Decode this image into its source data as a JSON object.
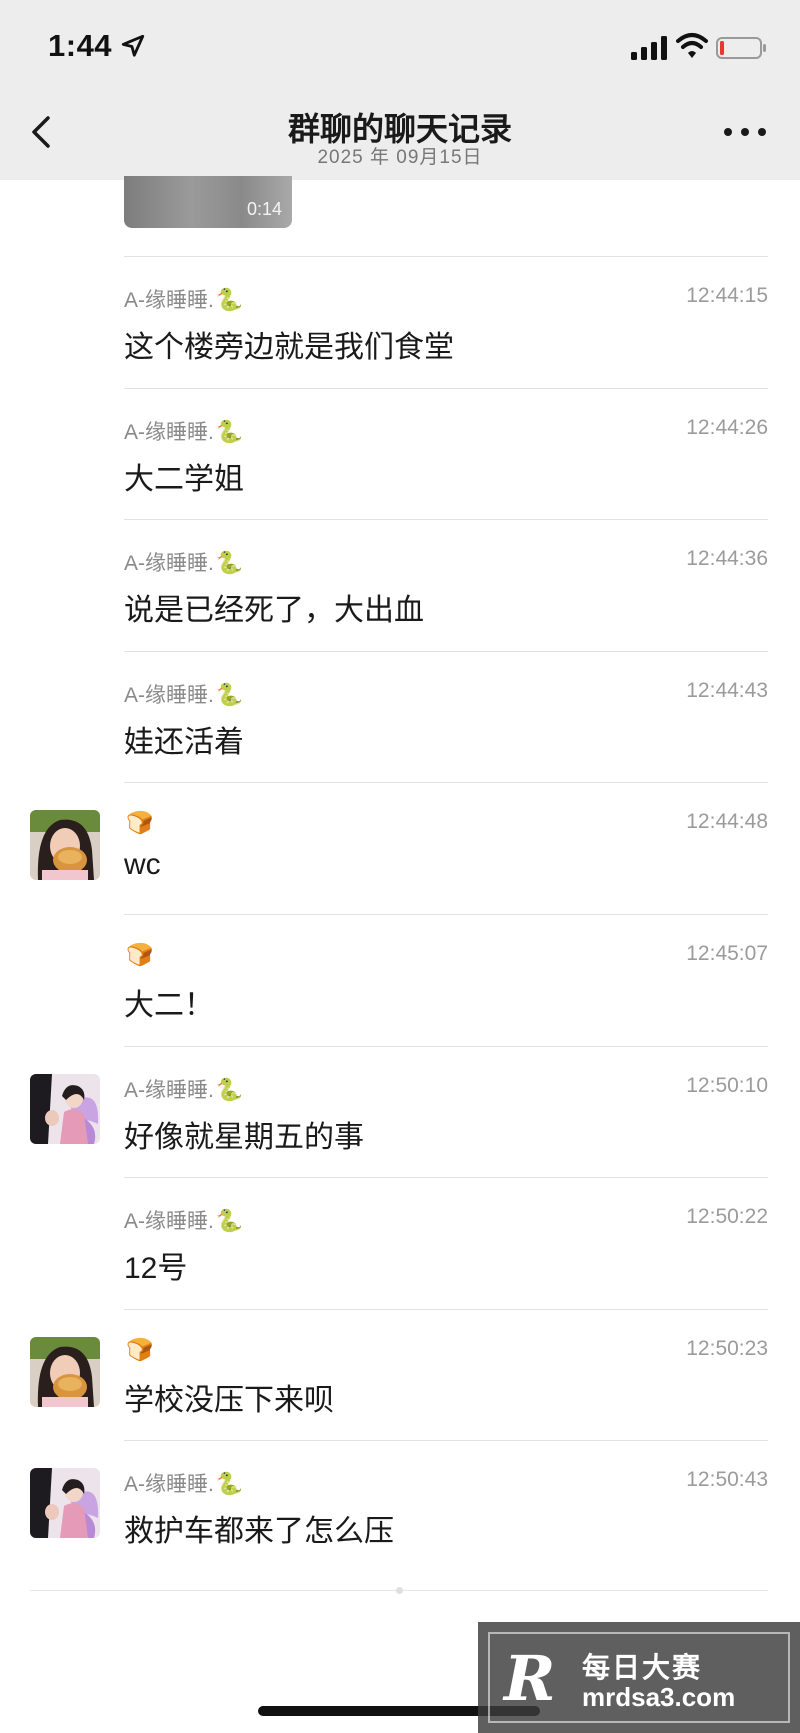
{
  "status_bar": {
    "time": "1:44"
  },
  "nav": {
    "title": "群聊的聊天记录",
    "date": "2025 年 09月15日"
  },
  "video": {
    "duration": "0:14"
  },
  "messages": [
    {
      "sender": "A-缘睡睡.",
      "sender_emoji": "🐍",
      "time": "12:44:15",
      "text": "这个楼旁边就是我们食堂",
      "avatar": null
    },
    {
      "sender": "A-缘睡睡.",
      "sender_emoji": "🐍",
      "time": "12:44:26",
      "text": "大二学姐",
      "avatar": null
    },
    {
      "sender": "A-缘睡睡.",
      "sender_emoji": "🐍",
      "time": "12:44:36",
      "text": "说是已经死了，大出血",
      "avatar": null
    },
    {
      "sender": "A-缘睡睡.",
      "sender_emoji": "🐍",
      "time": "12:44:43",
      "text": "娃还活着",
      "avatar": null
    },
    {
      "sender": "",
      "sender_emoji": "🍞",
      "time": "12:44:48",
      "text": "wc",
      "avatar": "girl-with-bread"
    },
    {
      "sender": "",
      "sender_emoji": "🍞",
      "time": "12:45:07",
      "text": "大二！",
      "avatar": null
    },
    {
      "sender": "A-缘睡睡.",
      "sender_emoji": "🐍",
      "time": "12:50:10",
      "text": "好像就星期五的事",
      "avatar": "fairy-girls"
    },
    {
      "sender": "A-缘睡睡.",
      "sender_emoji": "🐍",
      "time": "12:50:22",
      "text": "12号",
      "avatar": null
    },
    {
      "sender": "",
      "sender_emoji": "🍞",
      "time": "12:50:23",
      "text": "学校没压下来呗",
      "avatar": "girl-with-bread"
    },
    {
      "sender": "A-缘睡睡.",
      "sender_emoji": "🐍",
      "time": "12:50:43",
      "text": "救护车都来了怎么压",
      "avatar": "fairy-girls"
    }
  ],
  "watermark": {
    "logo": "R",
    "title": "每日大赛",
    "url": "mrdsa3.com"
  }
}
